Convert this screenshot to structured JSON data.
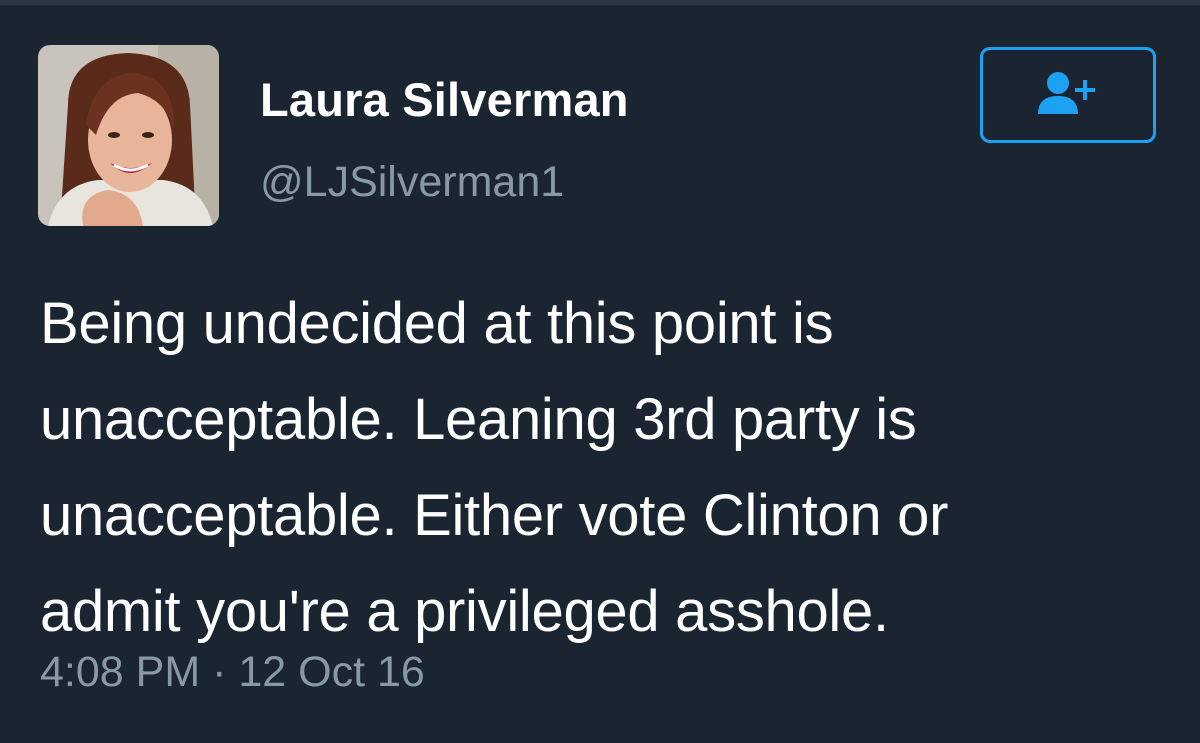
{
  "tweet": {
    "author": {
      "display_name": "Laura Silverman",
      "handle": "@LJSilverman1"
    },
    "follow_button": {
      "icon": "add-user-icon"
    },
    "text_lines": [
      "Being undecided at this point is",
      "unacceptable. Leaning 3rd party is",
      "unacceptable. Either vote Clinton or",
      "admit you're a privileged asshole."
    ],
    "timestamp": "4:08 PM · 12 Oct 16"
  },
  "colors": {
    "background": "#1b2531",
    "accent": "#1da1f2",
    "secondary_text": "#8899a6",
    "primary_text": "#ffffff"
  }
}
